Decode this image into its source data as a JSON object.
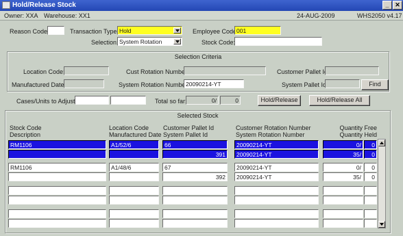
{
  "window": {
    "title": "Hold/Release Stock"
  },
  "info": {
    "owner": "Owner:  XXA",
    "warehouse": "Warehouse:  XX1",
    "date": "24-AUG-2009",
    "program": "WHS2050  v4.17"
  },
  "header": {
    "reason_label": "Reason Code:",
    "reason_value": "",
    "txn_label": "Transaction Type:",
    "txn_value": "Hold",
    "emp_label": "Employee Code:",
    "emp_value": "001",
    "selection_label": "Selection:",
    "selection_value": "System Rotation",
    "stock_label": "Stock Code:",
    "stock_value": ""
  },
  "criteria": {
    "title": "Selection Criteria",
    "location_label": "Location Code:",
    "location_value": "",
    "cust_rot_label": "Cust Rotation Number:",
    "cust_rot_value": "",
    "cust_pallet_label": "Customer Pallet Id:",
    "cust_pallet_value": "",
    "mfg_label": "Manufactured Date:",
    "mfg_value": "",
    "sys_rot_label": "System Rotation Number:",
    "sys_rot_value": "20090214-YT",
    "sys_pallet_label": "System Pallet Id:",
    "sys_pallet_value": "",
    "find_label": "Find"
  },
  "adjust": {
    "cases_label": "Cases/Units to Adjust:",
    "cases_value": "",
    "units_value": "",
    "total_label": "Total so far:",
    "total_cases": "0/",
    "total_units": "0",
    "hold_release_label": "Hold/Release",
    "hold_release_all_label": "Hold/Release All"
  },
  "stock": {
    "title": "Selected Stock",
    "col1a": "Stock Code",
    "col1b": "Description",
    "col2a": "Location Code",
    "col2b": "Manufactured Date",
    "col3a": "Customer Pallet Id",
    "col3b": "System Pallet Id",
    "col4a": "Customer Rotation Number",
    "col4b": "System Rotation Number",
    "col5a": "Quantity Free",
    "col5b": "Quantity Held",
    "rows": [
      {
        "stock": "RM1106",
        "desc": "",
        "loc": "A1/52/6",
        "mfg": "",
        "cust_pallet": "66",
        "sys_pallet": "391",
        "cust_rot": "20090214-YT",
        "sys_rot": "20090214-YT",
        "free_cases": "0/",
        "free_units": "0",
        "held_cases": "35/",
        "held_units": "0"
      },
      {
        "stock": "RM1106",
        "desc": "",
        "loc": "A1/48/6",
        "mfg": "",
        "cust_pallet": "67",
        "sys_pallet": "392",
        "cust_rot": "20090214-YT",
        "sys_rot": "20090214-YT",
        "free_cases": "0/",
        "free_units": "0",
        "held_cases": "35/",
        "held_units": "0"
      },
      {
        "stock": "",
        "desc": "",
        "loc": "",
        "mfg": "",
        "cust_pallet": "",
        "sys_pallet": "",
        "cust_rot": "",
        "sys_rot": "",
        "free_cases": "",
        "free_units": "",
        "held_cases": "",
        "held_units": ""
      },
      {
        "stock": "",
        "desc": "",
        "loc": "",
        "mfg": "",
        "cust_pallet": "",
        "sys_pallet": "",
        "cust_rot": "",
        "sys_rot": "",
        "free_cases": "",
        "free_units": "",
        "held_cases": "",
        "held_units": ""
      }
    ]
  }
}
